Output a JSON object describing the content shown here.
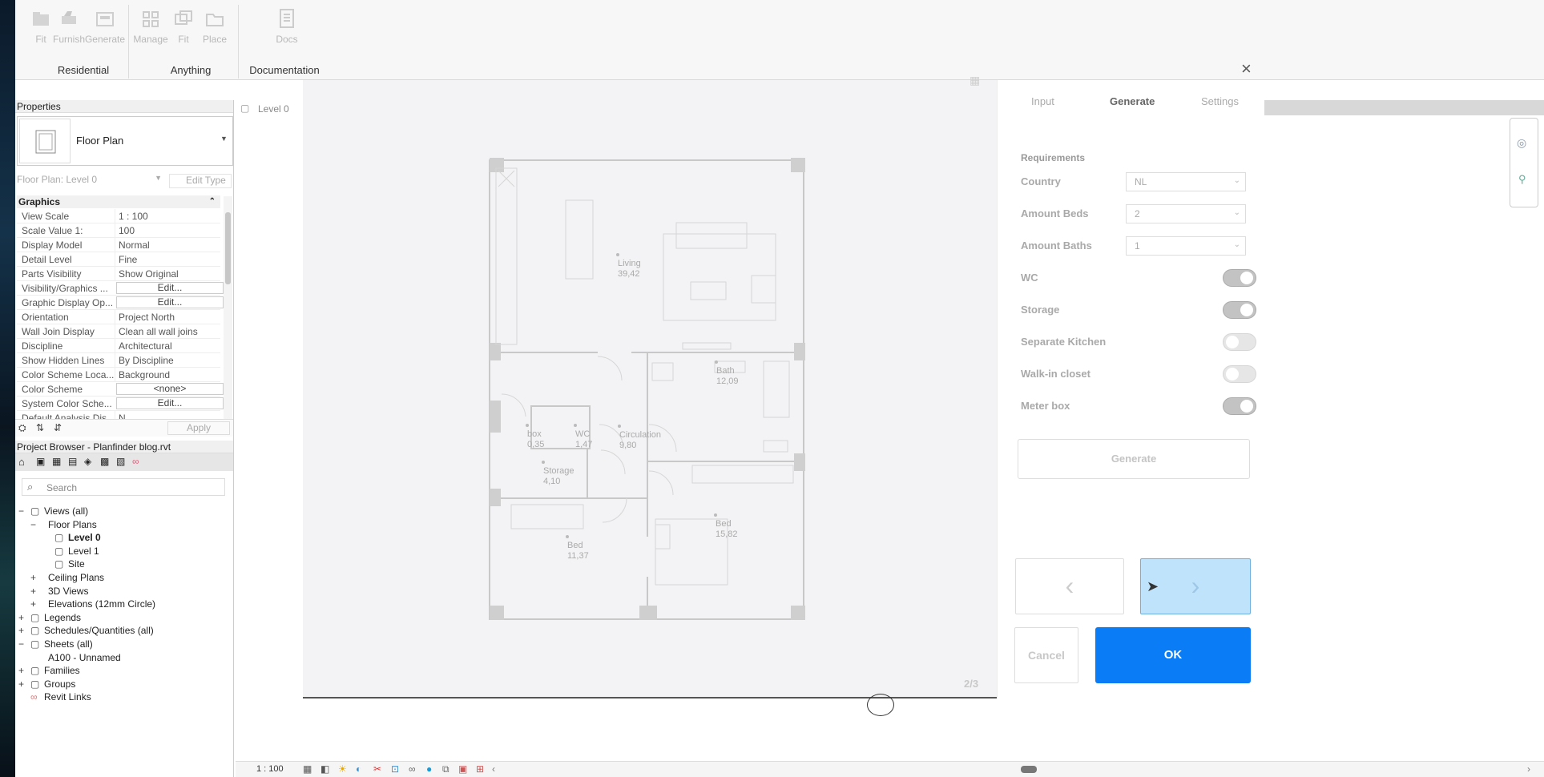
{
  "ribbon": {
    "buttons": [
      {
        "label": "Fit",
        "icon": "folder-icon"
      },
      {
        "label": "Furnish",
        "icon": "sofa-icon"
      },
      {
        "label": "Generate",
        "icon": "generate-icon"
      },
      {
        "label": "Manage",
        "icon": "grid-icon"
      },
      {
        "label": "Fit",
        "icon": "folders-icon"
      },
      {
        "label": "Place",
        "icon": "folder-outline-icon"
      },
      {
        "label": "Docs",
        "icon": "document-icon"
      }
    ],
    "groups": [
      "Residential",
      "Anything",
      "Documentation"
    ]
  },
  "properties": {
    "title": "Properties",
    "type_name": "Floor Plan",
    "instance_selector": "Floor Plan: Level 0",
    "edit_type": "Edit Type",
    "section": "Graphics",
    "rows": [
      {
        "k": "View Scale",
        "v": "1 : 100"
      },
      {
        "k": "Scale Value    1:",
        "v": "100"
      },
      {
        "k": "Display Model",
        "v": "Normal"
      },
      {
        "k": "Detail Level",
        "v": "Fine"
      },
      {
        "k": "Parts Visibility",
        "v": "Show Original"
      },
      {
        "k": "Visibility/Graphics ...",
        "v": "Edit..."
      },
      {
        "k": "Graphic Display Op...",
        "v": "Edit..."
      },
      {
        "k": "Orientation",
        "v": "Project North"
      },
      {
        "k": "Wall Join Display",
        "v": "Clean all wall joins"
      },
      {
        "k": "Discipline",
        "v": "Architectural"
      },
      {
        "k": "Show Hidden Lines",
        "v": "By Discipline"
      },
      {
        "k": "Color Scheme Loca...",
        "v": "Background"
      },
      {
        "k": "Color Scheme",
        "v": "<none>"
      },
      {
        "k": "System Color Sche...",
        "v": "Edit..."
      },
      {
        "k": "Default Analysis Dis...",
        "v": "N..."
      }
    ],
    "apply": "Apply"
  },
  "browser": {
    "title": "Project Browser - Planfinder blog.rvt",
    "search_placeholder": "Search",
    "nodes": [
      {
        "label": "Views (all)",
        "pm": "−",
        "indent": 0
      },
      {
        "label": "Floor Plans",
        "pm": "−",
        "indent": 1
      },
      {
        "label": "Level 0",
        "pm": "",
        "indent": 2
      },
      {
        "label": "Level 1",
        "pm": "",
        "indent": 2
      },
      {
        "label": "Site",
        "pm": "",
        "indent": 2
      },
      {
        "label": "Ceiling Plans",
        "pm": "+",
        "indent": 1
      },
      {
        "label": "3D Views",
        "pm": "+",
        "indent": 1
      },
      {
        "label": "Elevations (12mm Circle)",
        "pm": "+",
        "indent": 1
      },
      {
        "label": "Legends",
        "pm": "+",
        "indent": 0
      },
      {
        "label": "Schedules/Quantities (all)",
        "pm": "+",
        "indent": 0
      },
      {
        "label": "Sheets (all)",
        "pm": "−",
        "indent": 0
      },
      {
        "label": "A100 - Unnamed",
        "pm": "",
        "indent": 1
      },
      {
        "label": "Families",
        "pm": "+",
        "indent": 0
      },
      {
        "label": "Groups",
        "pm": "+",
        "indent": 0
      },
      {
        "label": "Revit Links",
        "pm": "",
        "indent": 0
      }
    ]
  },
  "view": {
    "tab": "Level 0",
    "scale": "1 : 100",
    "page_indicator": "2/3"
  },
  "plan": {
    "rooms": [
      {
        "name": "Living",
        "area": "39,42"
      },
      {
        "name": "Bath",
        "area": "12,09"
      },
      {
        "name": "Circulation",
        "area": "9,80"
      },
      {
        "name": "WC",
        "area": "1,47"
      },
      {
        "name": "box",
        "area": "0,35"
      },
      {
        "name": "Storage",
        "area": "4,10"
      },
      {
        "name": "Bed",
        "area": "11,37"
      },
      {
        "name": "Bed",
        "area": "15,82"
      }
    ]
  },
  "panel": {
    "tabs": [
      "Input",
      "Generate",
      "Settings"
    ],
    "active_tab": "Generate",
    "section": "Requirements",
    "selects": [
      {
        "label": "Country",
        "value": "NL"
      },
      {
        "label": "Amount Beds",
        "value": "2"
      },
      {
        "label": "Amount Baths",
        "value": "1"
      }
    ],
    "toggles": [
      {
        "label": "WC",
        "on": true
      },
      {
        "label": "Storage",
        "on": true
      },
      {
        "label": "Separate Kitchen",
        "on": false
      },
      {
        "label": "Walk-in closet",
        "on": false
      },
      {
        "label": "Meter box",
        "on": true
      }
    ],
    "generate": "Generate",
    "prev": "‹",
    "next": "›",
    "cancel": "Cancel",
    "ok": "OK",
    "accent": "#0a7cf5",
    "next_bg": "#bfe3fb"
  }
}
